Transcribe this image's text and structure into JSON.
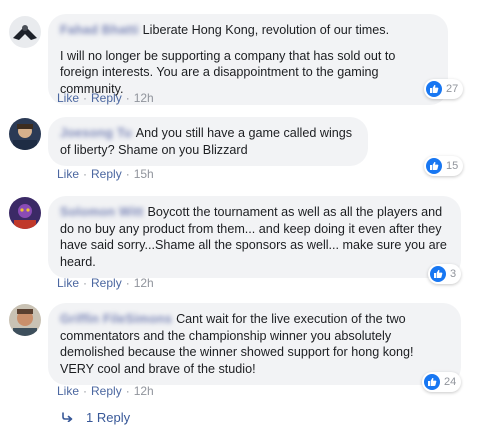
{
  "colors": {
    "bubble_bg": "#f2f3f5",
    "link": "#4b67a0",
    "muted": "#90949c",
    "like_blue": "#1877f2"
  },
  "actions": {
    "like": "Like",
    "reply": "Reply",
    "separator": "·"
  },
  "comments": [
    {
      "author": "Fahad Bhatti",
      "text": "Liberate Hong Kong, revolution of our times.",
      "text2": "I will no longer be supporting a company that has sold out to foreign interests. You are a disappointment to the gaming community.",
      "time": "12h",
      "reactions": "27",
      "reaction_icon": "thumbs-up-icon"
    },
    {
      "author": "Joesong Tu",
      "text": "And you still have a game called wings of liberty? Shame on you Blizzard",
      "time": "15h",
      "reactions": "15",
      "reaction_icon": "thumbs-up-icon"
    },
    {
      "author": "Solomon Witt",
      "text": "Boycott the tournament as well as all the players and do no buy any product from them... and keep doing it even after they have said sorry...Shame all the sponsors as well... make sure you are heard.",
      "time": "12h",
      "reactions": "3",
      "reaction_icon": "thumbs-up-icon"
    },
    {
      "author": "Griffin FileSimons",
      "text": "Cant wait for the live execution of the two commentators and the championship winner you absolutely demolished because the winner showed support for hong kong! VERY cool and brave of the studio!",
      "time": "12h",
      "reactions": "24",
      "reaction_icon": "thumbs-up-icon"
    }
  ],
  "replies": {
    "label": "1 Reply",
    "icon": "reply-arrow-icon"
  }
}
